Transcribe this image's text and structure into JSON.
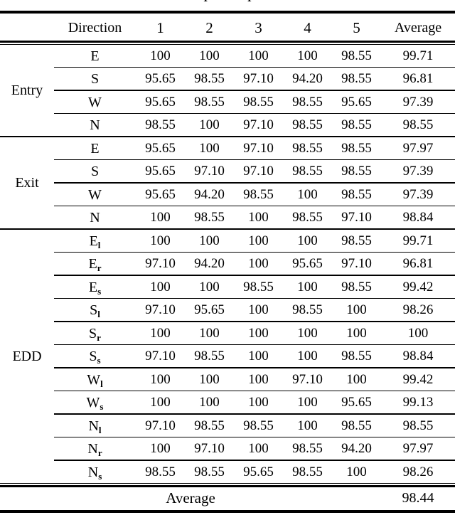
{
  "clipped_caption": "I I",
  "table": {
    "columns": [
      "Direction",
      "1",
      "2",
      "3",
      "4",
      "5",
      "Average"
    ],
    "header": {
      "group_label": "",
      "direction": "Direction",
      "run1": "1",
      "run2": "2",
      "run3": "3",
      "run4": "4",
      "run5": "5",
      "average": "Average"
    },
    "groups": [
      {
        "label": "Entry",
        "rows": [
          {
            "direction": "E",
            "sub": "",
            "values": [
              "100",
              "100",
              "100",
              "100",
              "98.55"
            ],
            "average": "99.71"
          },
          {
            "direction": "S",
            "sub": "",
            "values": [
              "95.65",
              "98.55",
              "97.10",
              "94.20",
              "98.55"
            ],
            "average": "96.81"
          },
          {
            "direction": "W",
            "sub": "",
            "values": [
              "95.65",
              "98.55",
              "98.55",
              "98.55",
              "95.65"
            ],
            "average": "97.39"
          },
          {
            "direction": "N",
            "sub": "",
            "values": [
              "98.55",
              "100",
              "97.10",
              "98.55",
              "98.55"
            ],
            "average": "98.55"
          }
        ]
      },
      {
        "label": "Exit",
        "rows": [
          {
            "direction": "E",
            "sub": "",
            "values": [
              "95.65",
              "100",
              "97.10",
              "98.55",
              "98.55"
            ],
            "average": "97.97"
          },
          {
            "direction": "S",
            "sub": "",
            "values": [
              "95.65",
              "97.10",
              "97.10",
              "98.55",
              "98.55"
            ],
            "average": "97.39"
          },
          {
            "direction": "W",
            "sub": "",
            "values": [
              "95.65",
              "94.20",
              "98.55",
              "100",
              "98.55"
            ],
            "average": "97.39"
          },
          {
            "direction": "N",
            "sub": "",
            "values": [
              "100",
              "98.55",
              "100",
              "98.55",
              "97.10"
            ],
            "average": "98.84"
          }
        ]
      },
      {
        "label": "EDD",
        "rows": [
          {
            "direction": "E",
            "sub": "l",
            "values": [
              "100",
              "100",
              "100",
              "100",
              "98.55"
            ],
            "average": "99.71"
          },
          {
            "direction": "E",
            "sub": "r",
            "values": [
              "97.10",
              "94.20",
              "100",
              "95.65",
              "97.10"
            ],
            "average": "96.81"
          },
          {
            "direction": "E",
            "sub": "s",
            "values": [
              "100",
              "100",
              "98.55",
              "100",
              "98.55"
            ],
            "average": "99.42"
          },
          {
            "direction": "S",
            "sub": "l",
            "values": [
              "97.10",
              "95.65",
              "100",
              "98.55",
              "100"
            ],
            "average": "98.26"
          },
          {
            "direction": "S",
            "sub": "r",
            "values": [
              "100",
              "100",
              "100",
              "100",
              "100"
            ],
            "average": "100"
          },
          {
            "direction": "S",
            "sub": "s",
            "values": [
              "97.10",
              "98.55",
              "100",
              "100",
              "98.55"
            ],
            "average": "98.84"
          },
          {
            "direction": "W",
            "sub": "l",
            "values": [
              "100",
              "100",
              "100",
              "97.10",
              "100"
            ],
            "average": "99.42"
          },
          {
            "direction": "W",
            "sub": "s",
            "values": [
              "100",
              "100",
              "100",
              "100",
              "95.65"
            ],
            "average": "99.13"
          },
          {
            "direction": "N",
            "sub": "l",
            "values": [
              "97.10",
              "98.55",
              "98.55",
              "100",
              "98.55"
            ],
            "average": "98.55"
          },
          {
            "direction": "N",
            "sub": "r",
            "values": [
              "100",
              "97.10",
              "100",
              "98.55",
              "94.20"
            ],
            "average": "97.97"
          },
          {
            "direction": "N",
            "sub": "s",
            "values": [
              "98.55",
              "98.55",
              "95.65",
              "98.55",
              "100"
            ],
            "average": "98.26"
          }
        ]
      }
    ],
    "footer": {
      "label": "Average",
      "value": "98.44"
    }
  }
}
